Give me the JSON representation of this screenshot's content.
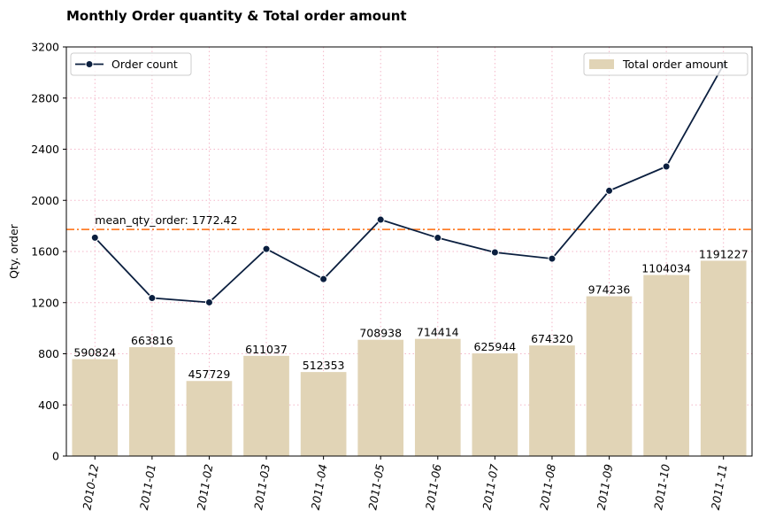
{
  "chart_data": {
    "type": "bar",
    "title": "Monthly Order quantity & Total order amount",
    "xlabel": "",
    "ylabel": "Qty. order",
    "ylim": [
      0,
      3200
    ],
    "yticks": [
      0,
      400,
      800,
      1200,
      1600,
      2000,
      2400,
      2800,
      3200
    ],
    "grid": true,
    "categories": [
      "2010-12",
      "2011-01",
      "2011-02",
      "2011-03",
      "2011-04",
      "2011-05",
      "2011-06",
      "2011-07",
      "2011-08",
      "2011-09",
      "2011-10",
      "2011-11"
    ],
    "series": [
      {
        "name": "Total order amount",
        "type": "bar",
        "color": "#e1d4b6",
        "values": [
          590824,
          663816,
          457729,
          611037,
          512353,
          708938,
          714414,
          625944,
          674320,
          974236,
          1104034,
          1191227
        ],
        "labels": [
          "590824",
          "663816",
          "457729",
          "611037",
          "512353",
          "708938",
          "714414",
          "625944",
          "674320",
          "974236",
          "1104034",
          "1191227"
        ],
        "legend_position": "upper right"
      },
      {
        "name": "Order count",
        "type": "line",
        "color": "#0b1f3f",
        "marker": "circle",
        "values": [
          1708,
          1236,
          1202,
          1620,
          1384,
          1849,
          1707,
          1593,
          1544,
          2075,
          2265,
          3060
        ],
        "legend_position": "upper left"
      }
    ],
    "annotations": [
      {
        "type": "hline",
        "value": 1772.42,
        "style": "dash-dot",
        "color": "#ff7f2a",
        "text": "mean_qty_order: 1772.42"
      }
    ]
  }
}
